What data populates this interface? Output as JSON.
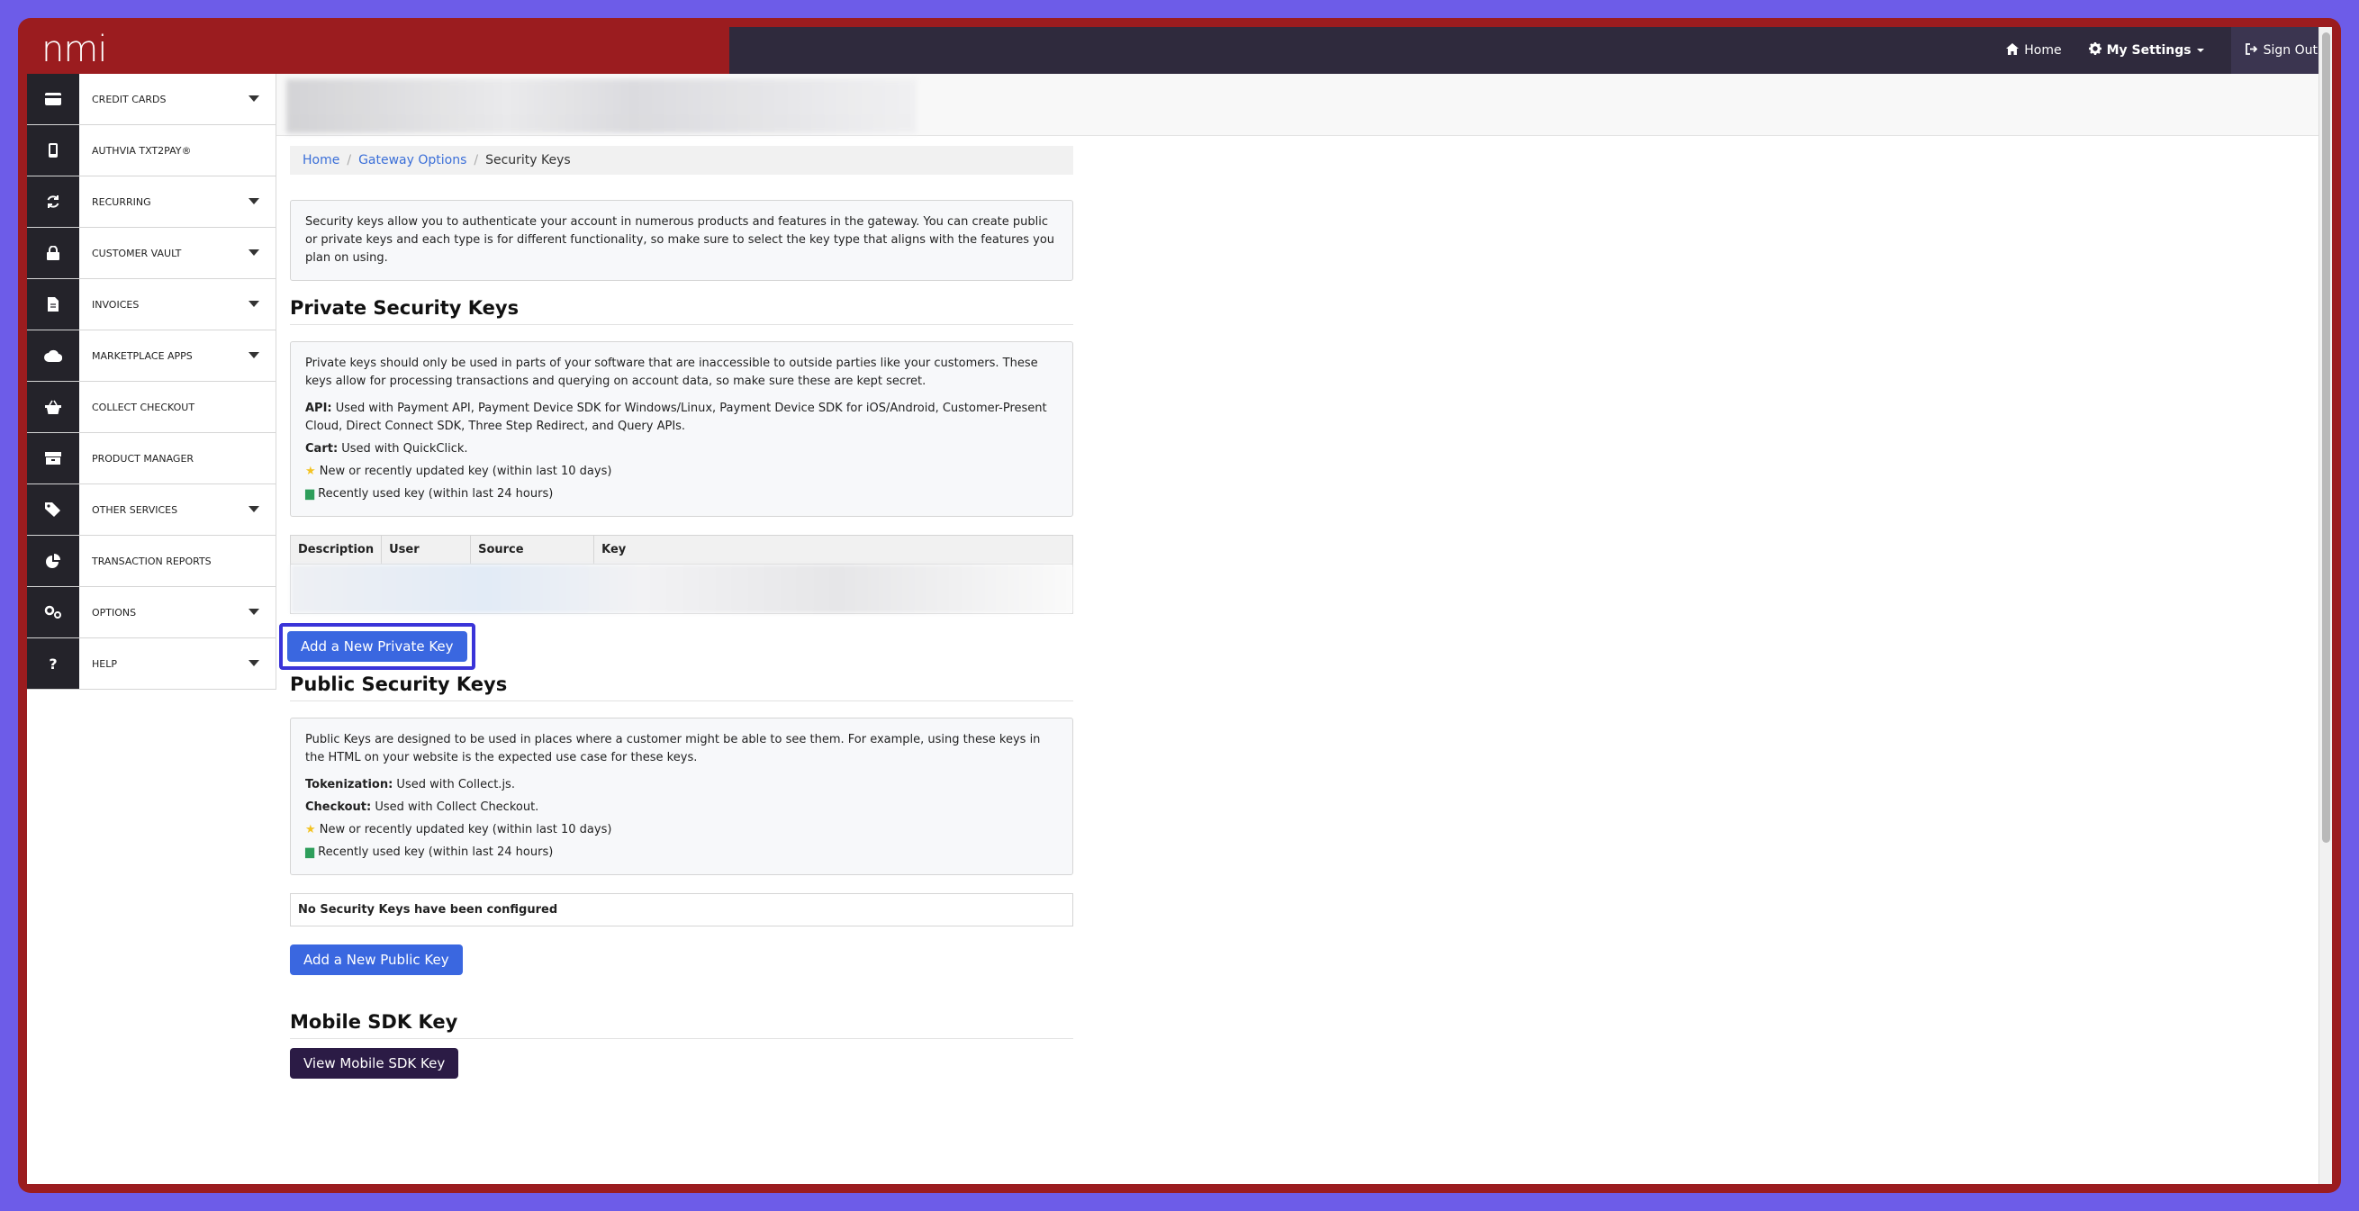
{
  "topbar": {
    "logo": "nmi",
    "nav": [
      {
        "label": "Home",
        "icon": "home-icon"
      },
      {
        "label": "My Settings",
        "icon": "gear-icon"
      },
      {
        "label": "Sign Out",
        "icon": "sign-out-icon"
      }
    ]
  },
  "sidebar": {
    "items": [
      {
        "label": "CREDIT CARDS",
        "icon": "credit-card-icon",
        "expandable": true
      },
      {
        "label": "AUTHVIA TXT2PAY®",
        "icon": "mobile-phone-icon",
        "expandable": false
      },
      {
        "label": "RECURRING",
        "icon": "refresh-icon",
        "expandable": true
      },
      {
        "label": "CUSTOMER VAULT",
        "icon": "lock-icon",
        "expandable": true
      },
      {
        "label": "INVOICES",
        "icon": "document-icon",
        "expandable": true
      },
      {
        "label": "MARKETPLACE APPS",
        "icon": "cloud-icon",
        "expandable": true
      },
      {
        "label": "COLLECT CHECKOUT",
        "icon": "basket-icon",
        "expandable": false
      },
      {
        "label": "PRODUCT MANAGER",
        "icon": "boxes-icon",
        "expandable": false
      },
      {
        "label": "OTHER SERVICES",
        "icon": "tags-icon",
        "expandable": true
      },
      {
        "label": "TRANSACTION REPORTS",
        "icon": "pie-chart-icon",
        "expandable": false
      },
      {
        "label": "OPTIONS",
        "icon": "cogs-icon",
        "expandable": true
      },
      {
        "label": "HELP",
        "icon": "question-icon",
        "expandable": true
      }
    ]
  },
  "breadcrumb": {
    "home": "Home",
    "sep": "/",
    "gateway": "Gateway Options",
    "current": "Security Keys"
  },
  "intro": "Security keys allow you to authenticate your account in numerous products and features in the gateway. You can create public or private keys and each type is for different functionality, so make sure to select the key type that aligns with the features you plan on using.",
  "private": {
    "heading": "Private Security Keys",
    "description": "Private keys should only be used in parts of your software that are inaccessible to outside parties like your customers. These keys allow for processing transactions and querying on account data, so make sure these are kept secret.",
    "api_label": "API:",
    "api_text": " Used with Payment API, Payment Device SDK for Windows/Linux, Payment Device SDK for iOS/Android, Customer-Present Cloud, Direct Connect SDK, Three Step Redirect, and Query APIs.",
    "cart_label": "Cart:",
    "cart_text": " Used with QuickClick.",
    "legend_new": "New or recently updated key (within last 10 days)",
    "legend_used": "Recently used key (within last 24 hours)",
    "table_headers": [
      "Description",
      "User",
      "Source",
      "Key"
    ],
    "add_button": "Add a New Private Key"
  },
  "public": {
    "heading": "Public Security Keys",
    "description": "Public Keys are designed to be used in places where a customer might be able to see them. For example, using these keys in the HTML on your website is the expected use case for these keys.",
    "tokenization_label": "Tokenization:",
    "tokenization_text": " Used with Collect.js.",
    "checkout_label": "Checkout:",
    "checkout_text": " Used with Collect Checkout.",
    "legend_new": "New or recently updated key (within last 10 days)",
    "legend_used": "Recently used key (within last 24 hours)",
    "empty_message": "No Security Keys have been configured",
    "add_button": "Add a New Public Key"
  },
  "mobile": {
    "heading": "Mobile SDK Key",
    "button": "View Mobile SDK Key"
  },
  "colors": {
    "brand_red": "#9b1c1f",
    "topbar_dark": "#2f2a3d",
    "primary_button": "#3a67e0",
    "dark_button": "#2b1b45",
    "link": "#3b6fd8"
  }
}
